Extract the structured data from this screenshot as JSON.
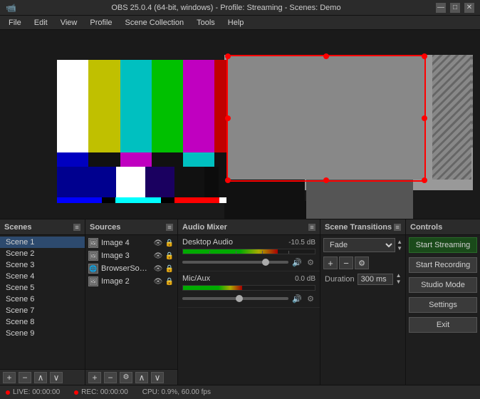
{
  "titleBar": {
    "title": "OBS 25.0.4 (64-bit, windows) - Profile: Streaming - Scenes: Demo",
    "minimize": "—",
    "maximize": "□",
    "close": "✕"
  },
  "menu": {
    "items": [
      "File",
      "Edit",
      "View",
      "Profile",
      "Scene Collection",
      "Tools",
      "Help"
    ]
  },
  "panels": {
    "scenes": {
      "header": "Scenes",
      "items": [
        "Scene 1",
        "Scene 2",
        "Scene 3",
        "Scene 4",
        "Scene 5",
        "Scene 6",
        "Scene 7",
        "Scene 8",
        "Scene 9"
      ]
    },
    "sources": {
      "header": "Sources",
      "items": [
        {
          "name": "Image 4",
          "type": "image"
        },
        {
          "name": "Image 3",
          "type": "image"
        },
        {
          "name": "BrowserSource",
          "type": "browser"
        },
        {
          "name": "Image 2",
          "type": "image"
        }
      ]
    },
    "audioMixer": {
      "header": "Audio Mixer",
      "tracks": [
        {
          "name": "Desktop Audio",
          "db": "-10.5 dB",
          "level": 72
        },
        {
          "name": "Mic/Aux",
          "db": "0.0 dB",
          "level": 45
        }
      ]
    },
    "sceneTransitions": {
      "header": "Scene Transitions",
      "transition": "Fade",
      "durationLabel": "Duration",
      "duration": "300 ms"
    },
    "controls": {
      "header": "Controls",
      "buttons": [
        "Start Streaming",
        "Start Recording",
        "Studio Mode",
        "Settings",
        "Exit"
      ]
    }
  },
  "statusBar": {
    "live": "LIVE: 00:00:00",
    "rec": "REC: 00:00:00",
    "cpu": "CPU: 0.9%, 60.00 fps"
  }
}
